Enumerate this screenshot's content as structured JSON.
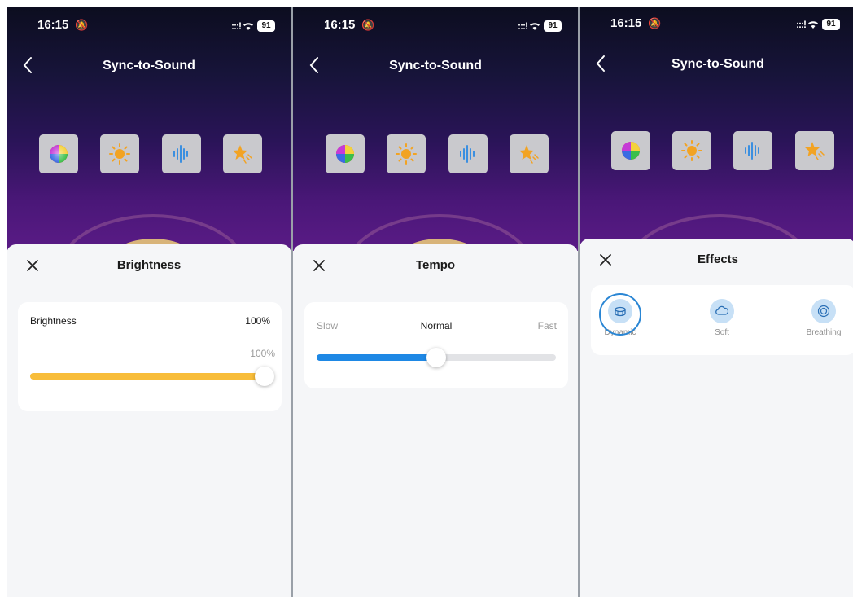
{
  "status_bar": {
    "time": "16:15",
    "signal": ":::!",
    "battery": "91"
  },
  "screens": [
    {
      "header": {
        "title": "Sync-to-Sound"
      },
      "sheet": {
        "title": "Brightness",
        "brightness": {
          "label": "Brightness",
          "value_text": "100%",
          "slider_readout": "100%",
          "level": 1.0
        }
      }
    },
    {
      "header": {
        "title": "Sync-to-Sound"
      },
      "sheet": {
        "title": "Tempo",
        "tempo": {
          "min_label": "Slow",
          "mid_label": "Normal",
          "max_label": "Fast",
          "level": 0.5
        }
      }
    },
    {
      "header": {
        "title": "Sync-to-Sound"
      },
      "sheet": {
        "title": "Effects",
        "effects": [
          {
            "label": "Dynamic",
            "icon": "drum-icon",
            "selected": true
          },
          {
            "label": "Soft",
            "icon": "cloud-icon",
            "selected": false
          },
          {
            "label": "Breathing",
            "icon": "concentric-circles-icon",
            "selected": false
          }
        ]
      }
    }
  ],
  "mode_buttons": [
    {
      "icon": "color-wheel-icon"
    },
    {
      "icon": "sun-brightness-icon"
    },
    {
      "icon": "sound-wave-icon"
    },
    {
      "icon": "star-effects-icon"
    }
  ],
  "colors": {
    "brightness_fill": "#f8bd3a",
    "tempo_fill": "#1e88e5",
    "effect_circle": "#c7e0f6",
    "selected_ring": "#2a86d4"
  }
}
